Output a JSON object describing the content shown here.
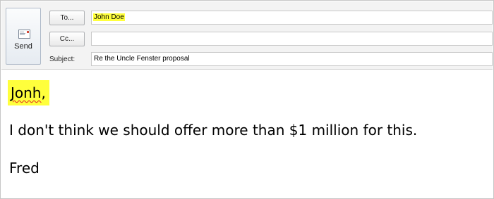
{
  "compose": {
    "send_label": "Send",
    "to_button": "To...",
    "cc_button": "Cc...",
    "subject_label": "Subject:",
    "to_value": "John Doe",
    "cc_value": "",
    "subject_value": "Re the Uncle Fenster proposal"
  },
  "message": {
    "greeting_word": "Jonh",
    "greeting_punct": ",",
    "body": "I don't think we should offer more than $1 million for this.",
    "signature": "Fred"
  },
  "colors": {
    "highlight": "#ffff3c",
    "spellcheck_underline": "#e02020"
  }
}
